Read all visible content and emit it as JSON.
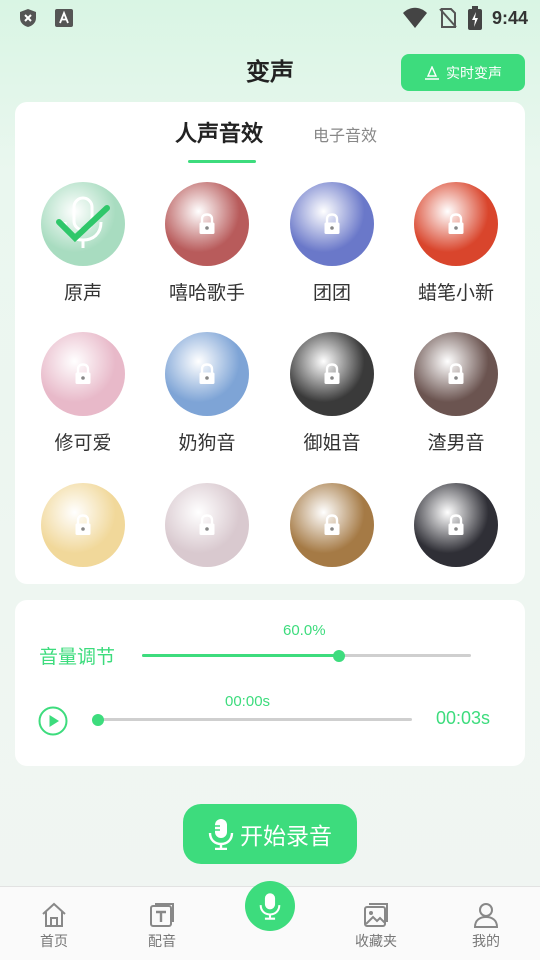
{
  "status_bar": {
    "time": "9:44",
    "icons": [
      "shield-icon",
      "font-a-icon",
      "wifi-icon",
      "no-sim-icon",
      "battery-charging-icon"
    ]
  },
  "header": {
    "title": "变声",
    "realtime_button": "实时变声"
  },
  "tabs": [
    {
      "label": "人声音效",
      "active": true
    },
    {
      "label": "电子音效",
      "active": false
    }
  ],
  "voices": [
    {
      "label": "原声",
      "locked": false,
      "selected": true,
      "color": "#a8dcc0"
    },
    {
      "label": "嘻哈歌手",
      "locked": true,
      "color": "#b85b5b"
    },
    {
      "label": "团团",
      "locked": true,
      "color": "#6a78c9"
    },
    {
      "label": "蜡笔小新",
      "locked": true,
      "color": "#d9452c"
    },
    {
      "label": "修可爱",
      "locked": true,
      "color": "#e8b9c9"
    },
    {
      "label": "奶狗音",
      "locked": true,
      "color": "#7ea4d6"
    },
    {
      "label": "御姐音",
      "locked": true,
      "color": "#3a3a3a"
    },
    {
      "label": "渣男音",
      "locked": true,
      "color": "#6b5450"
    },
    {
      "label": "",
      "locked": true,
      "color": "#f1d89a"
    },
    {
      "label": "",
      "locked": true,
      "color": "#d9c9cf"
    },
    {
      "label": "",
      "locked": true,
      "color": "#a57a45"
    },
    {
      "label": "",
      "locked": true,
      "color": "#2f2f36"
    }
  ],
  "volume": {
    "label": "音量调节",
    "value_text": "60.0%",
    "value": 0.6
  },
  "playback": {
    "current": "00:00s",
    "total": "00:03s",
    "progress": 0.0
  },
  "record_button": "开始录音",
  "nav": [
    {
      "label": "首页",
      "icon": "home-icon"
    },
    {
      "label": "配音",
      "icon": "text-icon"
    },
    {
      "label": "",
      "icon": "mic-icon"
    },
    {
      "label": "收藏夹",
      "icon": "image-icon"
    },
    {
      "label": "我的",
      "icon": "user-icon"
    }
  ],
  "colors": {
    "accent": "#3ddc7d",
    "track": "#cfcfcf"
  }
}
